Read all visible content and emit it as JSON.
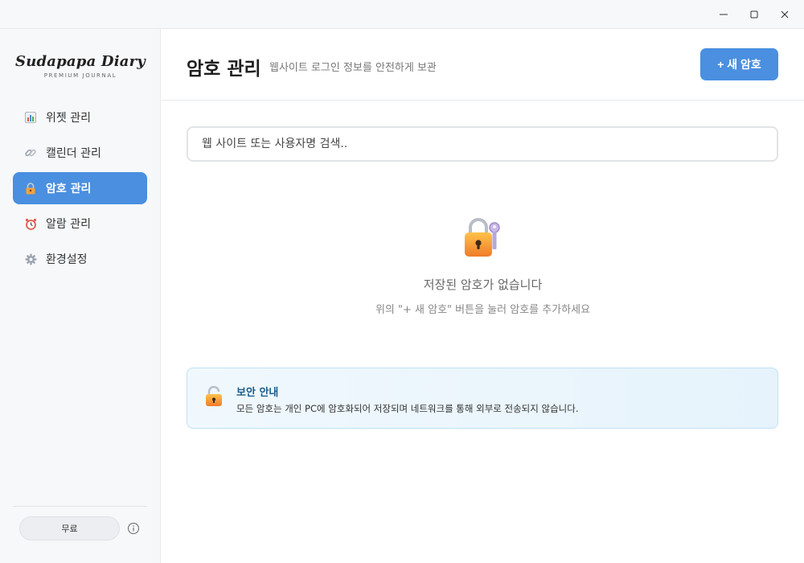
{
  "window": {
    "controls": {
      "minimize_icon": "minimize-icon",
      "maximize_icon": "maximize-icon",
      "close_icon": "close-icon"
    }
  },
  "sidebar": {
    "logo": {
      "title": "Sudapapa Diary",
      "subtitle": "PREMIUM JOURNAL"
    },
    "items": [
      {
        "label": "위젯 관리",
        "icon": "bar-chart-icon",
        "active": false
      },
      {
        "label": "캘린더 관리",
        "icon": "link-icon",
        "active": false
      },
      {
        "label": "암호 관리",
        "icon": "lock-icon",
        "active": true
      },
      {
        "label": "알람 관리",
        "icon": "alarm-clock-icon",
        "active": false
      },
      {
        "label": "환경설정",
        "icon": "gear-icon",
        "active": false
      }
    ],
    "plan_label": "무료",
    "info_icon": "info-icon"
  },
  "header": {
    "title": "암호 관리",
    "subtitle": "웹사이트 로그인 정보를 안전하게 보관",
    "add_button_label": "+ 새 암호"
  },
  "search": {
    "placeholder": "웹 사이트 또는 사용자명 검색.."
  },
  "empty_state": {
    "icon": "lock-with-key-icon",
    "title": "저장된 암호가 없습니다",
    "description": "위의 \"+ 새 암호\" 버튼을 눌러 암호를 추가하세요"
  },
  "notice": {
    "icon": "open-lock-icon",
    "title": "보안 안내",
    "text": "모든 암호는 개인 PC에 암호화되어 저장되며 네트워크를 통해 외부로 전송되지 않습니다."
  },
  "colors": {
    "accent": "#4a8fe0",
    "notice_border": "#bfe1f5",
    "notice_title": "#1a5c8a"
  }
}
